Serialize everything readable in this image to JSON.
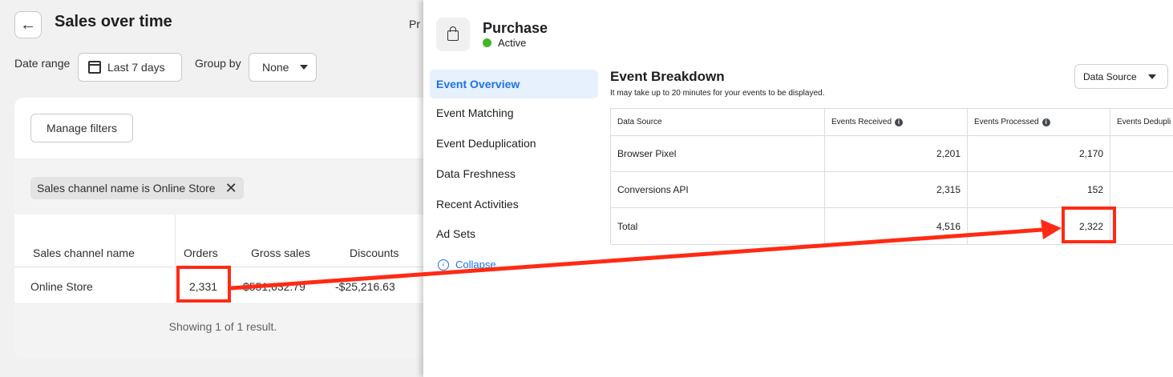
{
  "report": {
    "title": "Sales over time",
    "cut_text": "Pr",
    "date_range_label": "Date range",
    "date_range_value": "Last 7 days",
    "group_by_label": "Group by",
    "group_by_value": "None",
    "manage_filters": "Manage filters",
    "filter_chip": "Sales channel name is Online Store",
    "columns": [
      "Sales channel name",
      "Orders",
      "Gross sales",
      "Discounts"
    ],
    "row": {
      "name": "Online Store",
      "orders": "2,331",
      "gross_sales": "$551,632.79",
      "discounts": "-$25,216.63"
    },
    "footer": "Showing 1 of 1 result."
  },
  "event": {
    "name": "Purchase",
    "status": "Active",
    "status_color": "#42b72a",
    "nav": [
      "Event Overview",
      "Event Matching",
      "Event Deduplication",
      "Data Freshness",
      "Recent Activities",
      "Ad Sets"
    ],
    "collapse": "Collapse",
    "breakdown_title": "Event Breakdown",
    "breakdown_subtitle": "It may take up to 20 minutes for your events to be displayed.",
    "data_source_button": "Data Source",
    "table": {
      "headers": [
        "Data Source",
        "Events Received",
        "Events Processed",
        "Events Dedupli"
      ],
      "rows": [
        {
          "source": "Browser Pixel",
          "received": "2,201",
          "processed": "2,170"
        },
        {
          "source": "Conversions API",
          "received": "2,315",
          "processed": "152"
        },
        {
          "source": "Total",
          "received": "4,516",
          "processed": "2,322"
        }
      ]
    }
  },
  "annotation": {
    "color": "#ff2a14"
  }
}
